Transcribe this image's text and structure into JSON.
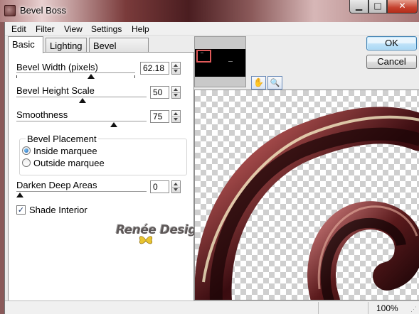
{
  "window": {
    "title": "Bevel Boss",
    "minimize_glyph": "▁",
    "maximize_glyph": "□",
    "close_glyph": "✕"
  },
  "menu": [
    "Edit",
    "Filter",
    "View",
    "Settings",
    "Help"
  ],
  "tabs": {
    "basic": "Basic",
    "lighting": "Lighting",
    "bevel_profile": "Bevel Profile"
  },
  "basic": {
    "bevel_width": {
      "label": "Bevel Width (pixels)",
      "value": "62.18"
    },
    "bevel_height_scale": {
      "label": "Bevel Height Scale",
      "value": "50"
    },
    "smoothness": {
      "label": "Smoothness",
      "value": "75"
    },
    "placement": {
      "title": "Bevel Placement",
      "inside": "Inside marquee",
      "outside": "Outside marquee",
      "selected": "inside"
    },
    "darken_deep_areas": {
      "label": "Darken Deep Areas",
      "value": "0"
    },
    "shade_interior": {
      "label": "Shade Interior",
      "checked": true
    }
  },
  "watermark": "Renée Design",
  "buttons": {
    "ok": "OK",
    "cancel": "Cancel"
  },
  "tools": {
    "hand": "✋",
    "zoom": "🔍"
  },
  "status": {
    "zoom": "100%"
  },
  "colors": {
    "accent": "#3c7fb1",
    "navigator_frame": "#e05a5a",
    "ring_dark": "#2a0a0c",
    "ring_mid": "#7a3030"
  }
}
